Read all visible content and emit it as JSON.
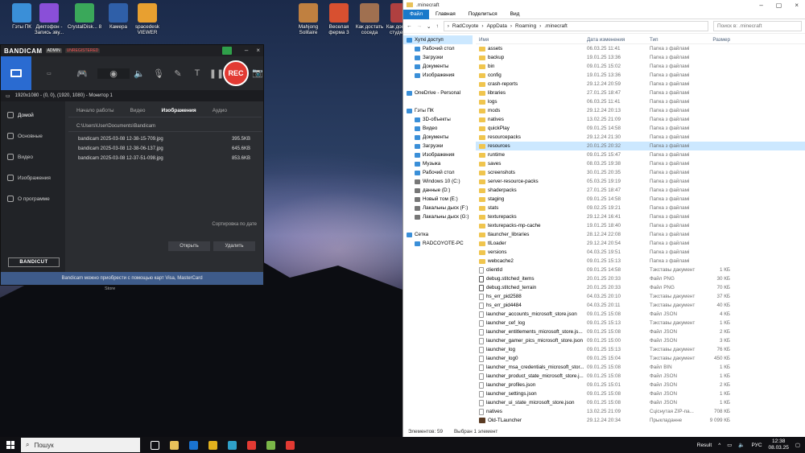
{
  "desktop_icons": [
    {
      "label": "Гэты ПК",
      "color": "#3a8fd8"
    },
    {
      "label": "Диктофон - Запись зву...",
      "color": "#8a4fd8"
    },
    {
      "label": "CrystalDisk... 8",
      "color": "#3aa85a"
    },
    {
      "label": "Камера",
      "color": "#2f5fa8"
    },
    {
      "label": "spacedesk VIEWER",
      "color": "#e8a030"
    },
    {
      "label": "Mahjong Solitaire",
      "color": "#c08040"
    },
    {
      "label": "Веселая ферма 3",
      "color": "#d85030"
    },
    {
      "label": "Как достать соседа",
      "color": "#a07050"
    },
    {
      "label": "Как достать студента",
      "color": "#b04040"
    }
  ],
  "bandicam": {
    "logo": "BANDICAM",
    "badge_admin": "ADMIN",
    "badge_unreg": "UNREGISTERED",
    "rec_label": "REC",
    "info": "1920x1080 - (0, 0), (1920, 1080) - Монитор 1",
    "side": [
      "Домой",
      "Основные",
      "Видео",
      "Изображения",
      "О программе"
    ],
    "tabs": [
      "Начало работы",
      "Видео",
      "Изображения",
      "Аудио"
    ],
    "path": "C:\\Users\\User\\Documents\\Bandicam",
    "files": [
      {
        "name": "bandicam 2025-03-08 12-38-15-709.jpg",
        "size": "395.5KB"
      },
      {
        "name": "bandicam 2025-03-08 12-38-06-137.jpg",
        "size": "645.6KB"
      },
      {
        "name": "bandicam 2025-03-08 12-37-51-098.jpg",
        "size": "853.6KB"
      }
    ],
    "sort": "Сортировка по дате",
    "open": "Открыть",
    "delete": "Удалить",
    "bandicut": "BANDICUT",
    "footer": "Bandicam можно приобрести с помощью карт Visa, MasterCard",
    "store": "Store"
  },
  "explorer": {
    "title": ".minecraft",
    "ribbon": [
      "Файл",
      "Главная",
      "Поделиться",
      "Вид"
    ],
    "crumbs": [
      "RadCoyote",
      "AppData",
      "Roaming",
      ".minecraft"
    ],
    "search": "Поиск в: .minecraft",
    "headers": [
      "Имя",
      "Дата изменения",
      "Тип",
      "Размер"
    ],
    "nav": [
      {
        "t": "Хуткі доступ",
        "k": "q",
        "sel": true
      },
      {
        "t": "Рабочий стол",
        "k": "b"
      },
      {
        "t": "Загрузки",
        "k": "b"
      },
      {
        "t": "Документы",
        "k": "b"
      },
      {
        "t": "Изображения",
        "k": "b"
      },
      {
        "t": "",
        "k": ""
      },
      {
        "t": "OneDrive - Personal",
        "k": "b"
      },
      {
        "t": "",
        "k": ""
      },
      {
        "t": "Гэты ПК",
        "k": "b"
      },
      {
        "t": "3D-объекты",
        "k": "b"
      },
      {
        "t": "Видео",
        "k": "b"
      },
      {
        "t": "Документы",
        "k": "b"
      },
      {
        "t": "Загрузки",
        "k": "b"
      },
      {
        "t": "Изображения",
        "k": "b"
      },
      {
        "t": "Музыка",
        "k": "b"
      },
      {
        "t": "Рабочий стол",
        "k": "b"
      },
      {
        "t": "Windows 10 (C:)",
        "k": "d"
      },
      {
        "t": "данные (D:)",
        "k": "d"
      },
      {
        "t": "Новый том (E:)",
        "k": "d"
      },
      {
        "t": "Лакальны дыск (F:)",
        "k": "d"
      },
      {
        "t": "Лакальны дыск (G:)",
        "k": "d"
      },
      {
        "t": "",
        "k": ""
      },
      {
        "t": "Сетка",
        "k": "b"
      },
      {
        "t": "RADCOYOTE-PC",
        "k": "b"
      }
    ],
    "rows": [
      [
        "assets",
        "06.03.25 11:41",
        "Папка з файламі",
        "",
        "f"
      ],
      [
        "backup",
        "19.01.25 13:36",
        "Папка з файламі",
        "",
        "f"
      ],
      [
        "bin",
        "09.01.25 15:02",
        "Папка з файламі",
        "",
        "f"
      ],
      [
        "config",
        "19.01.25 13:36",
        "Папка з файламі",
        "",
        "f"
      ],
      [
        "crash-reports",
        "29.12.24 20:59",
        "Папка з файламі",
        "",
        "f"
      ],
      [
        "libraries",
        "27.01.25 18:47",
        "Папка з файламі",
        "",
        "f"
      ],
      [
        "logs",
        "06.03.25 11:41",
        "Папка з файламі",
        "",
        "f"
      ],
      [
        "mods",
        "29.12.24 20:13",
        "Папка з файламі",
        "",
        "f"
      ],
      [
        "natives",
        "13.02.25 21:09",
        "Папка з файламі",
        "",
        "f"
      ],
      [
        "quickPlay",
        "09.01.25 14:58",
        "Папка з файламі",
        "",
        "f"
      ],
      [
        "resourcepacks",
        "29.12.24 21:30",
        "Папка з файламі",
        "",
        "f"
      ],
      [
        "resources",
        "20.01.25 20:32",
        "Папка з файламі",
        "",
        "f",
        "sel"
      ],
      [
        "runtime",
        "09.01.25 15:47",
        "Папка з файламі",
        "",
        "f"
      ],
      [
        "saves",
        "08.03.25 19:38",
        "Папка з файламі",
        "",
        "f"
      ],
      [
        "screenshots",
        "30.01.25 20:35",
        "Папка з файламі",
        "",
        "f"
      ],
      [
        "server-resource-packs",
        "05.03.25 19:19",
        "Папка з файламі",
        "",
        "f"
      ],
      [
        "shaderpacks",
        "27.01.25 18:47",
        "Папка з файламі",
        "",
        "f"
      ],
      [
        "staging",
        "09.01.25 14:58",
        "Папка з файламі",
        "",
        "f"
      ],
      [
        "stats",
        "09.02.25 19:21",
        "Папка з файламі",
        "",
        "f"
      ],
      [
        "texturepacks",
        "29.12.24 16:41",
        "Папка з файламі",
        "",
        "f"
      ],
      [
        "texturepacks-mp-cache",
        "19.01.25 18:40",
        "Папка з файламі",
        "",
        "f"
      ],
      [
        "tlauncher_libraries",
        "28.12.24 22:08",
        "Папка з файламі",
        "",
        "f"
      ],
      [
        "tlLoader",
        "29.12.24 20:54",
        "Папка з файламі",
        "",
        "f"
      ],
      [
        "versions",
        "04.03.25 19:51",
        "Папка з файламі",
        "",
        "f"
      ],
      [
        "webcache2",
        "09.01.25 15:13",
        "Папка з файламі",
        "",
        "f"
      ],
      [
        "clientId",
        "09.01.25 14:58",
        "Тэкставы дакумент",
        "1 КБ",
        "t"
      ],
      [
        "debug.stitched_items",
        "20.01.25 20:33",
        "Файл PNG",
        "30 КБ",
        "c"
      ],
      [
        "debug.stitched_terrain",
        "20.01.25 20:33",
        "Файл PNG",
        "70 КБ",
        "c"
      ],
      [
        "hs_err_pid2588",
        "04.03.25 20:10",
        "Тэкставы дакумент",
        "37 КБ",
        "t"
      ],
      [
        "hs_err_pid4484",
        "04.03.25 20:11",
        "Тэкставы дакумент",
        "40 КБ",
        "t"
      ],
      [
        "launcher_accounts_microsoft_store.json",
        "09.01.25 15:08",
        "Файл JSON",
        "4 КБ",
        "t"
      ],
      [
        "launcher_cef_log",
        "09.01.25 15:13",
        "Тэкставы дакумент",
        "1 КБ",
        "t"
      ],
      [
        "launcher_entitlements_microsoft_store.js...",
        "09.01.25 15:08",
        "Файл JSON",
        "2 КБ",
        "t"
      ],
      [
        "launcher_gamer_pics_microsoft_store.json",
        "09.01.25 15:00",
        "Файл JSON",
        "3 КБ",
        "t"
      ],
      [
        "launcher_log",
        "09.01.25 15:13",
        "Тэкставы дакумент",
        "76 КБ",
        "t"
      ],
      [
        "launcher_log0",
        "09.01.25 15:04",
        "Тэкставы дакумент",
        "450 КБ",
        "t"
      ],
      [
        "launcher_msa_credentials_microsoft_stor...",
        "09.01.25 15:08",
        "Файл BIN",
        "1 КБ",
        "t"
      ],
      [
        "launcher_product_state_microsoft_store.j...",
        "09.01.25 15:08",
        "Файл JSON",
        "1 КБ",
        "t"
      ],
      [
        "launcher_profiles.json",
        "09.01.25 15:01",
        "Файл JSON",
        "2 КБ",
        "t"
      ],
      [
        "launcher_settings.json",
        "09.01.25 15:08",
        "Файл JSON",
        "1 КБ",
        "t"
      ],
      [
        "launcher_ui_state_microsoft_store.json",
        "09.01.25 15:08",
        "Файл JSON",
        "1 КБ",
        "t"
      ],
      [
        "natives",
        "13.02.25 21:09",
        "Сціснутая ZIP-па...",
        "708 КБ",
        "t"
      ],
      [
        "Old-TLauncher",
        "29.12.24 20:34",
        "Прыкладанне",
        "9 099 КБ",
        "a"
      ]
    ],
    "status_count": "Элементов: 59",
    "status_sel": "Выбран 1 элемент"
  },
  "taskbar": {
    "search": "Пошук",
    "apps": [
      {
        "name": "task-view",
        "color": "#ffffff"
      },
      {
        "name": "explorer",
        "color": "#e8c25a"
      },
      {
        "name": "outlook",
        "color": "#1a73d0"
      },
      {
        "name": "chrome",
        "color": "#e2b11d"
      },
      {
        "name": "edge",
        "color": "#2fa0c8"
      },
      {
        "name": "yandex",
        "color": "#e23a33"
      },
      {
        "name": "minecraft",
        "color": "#7ab648"
      },
      {
        "name": "bandicam",
        "color": "#e23a33"
      }
    ],
    "result": "Result",
    "lang": "РУС",
    "time": "12:38",
    "date": "08.03.25"
  }
}
